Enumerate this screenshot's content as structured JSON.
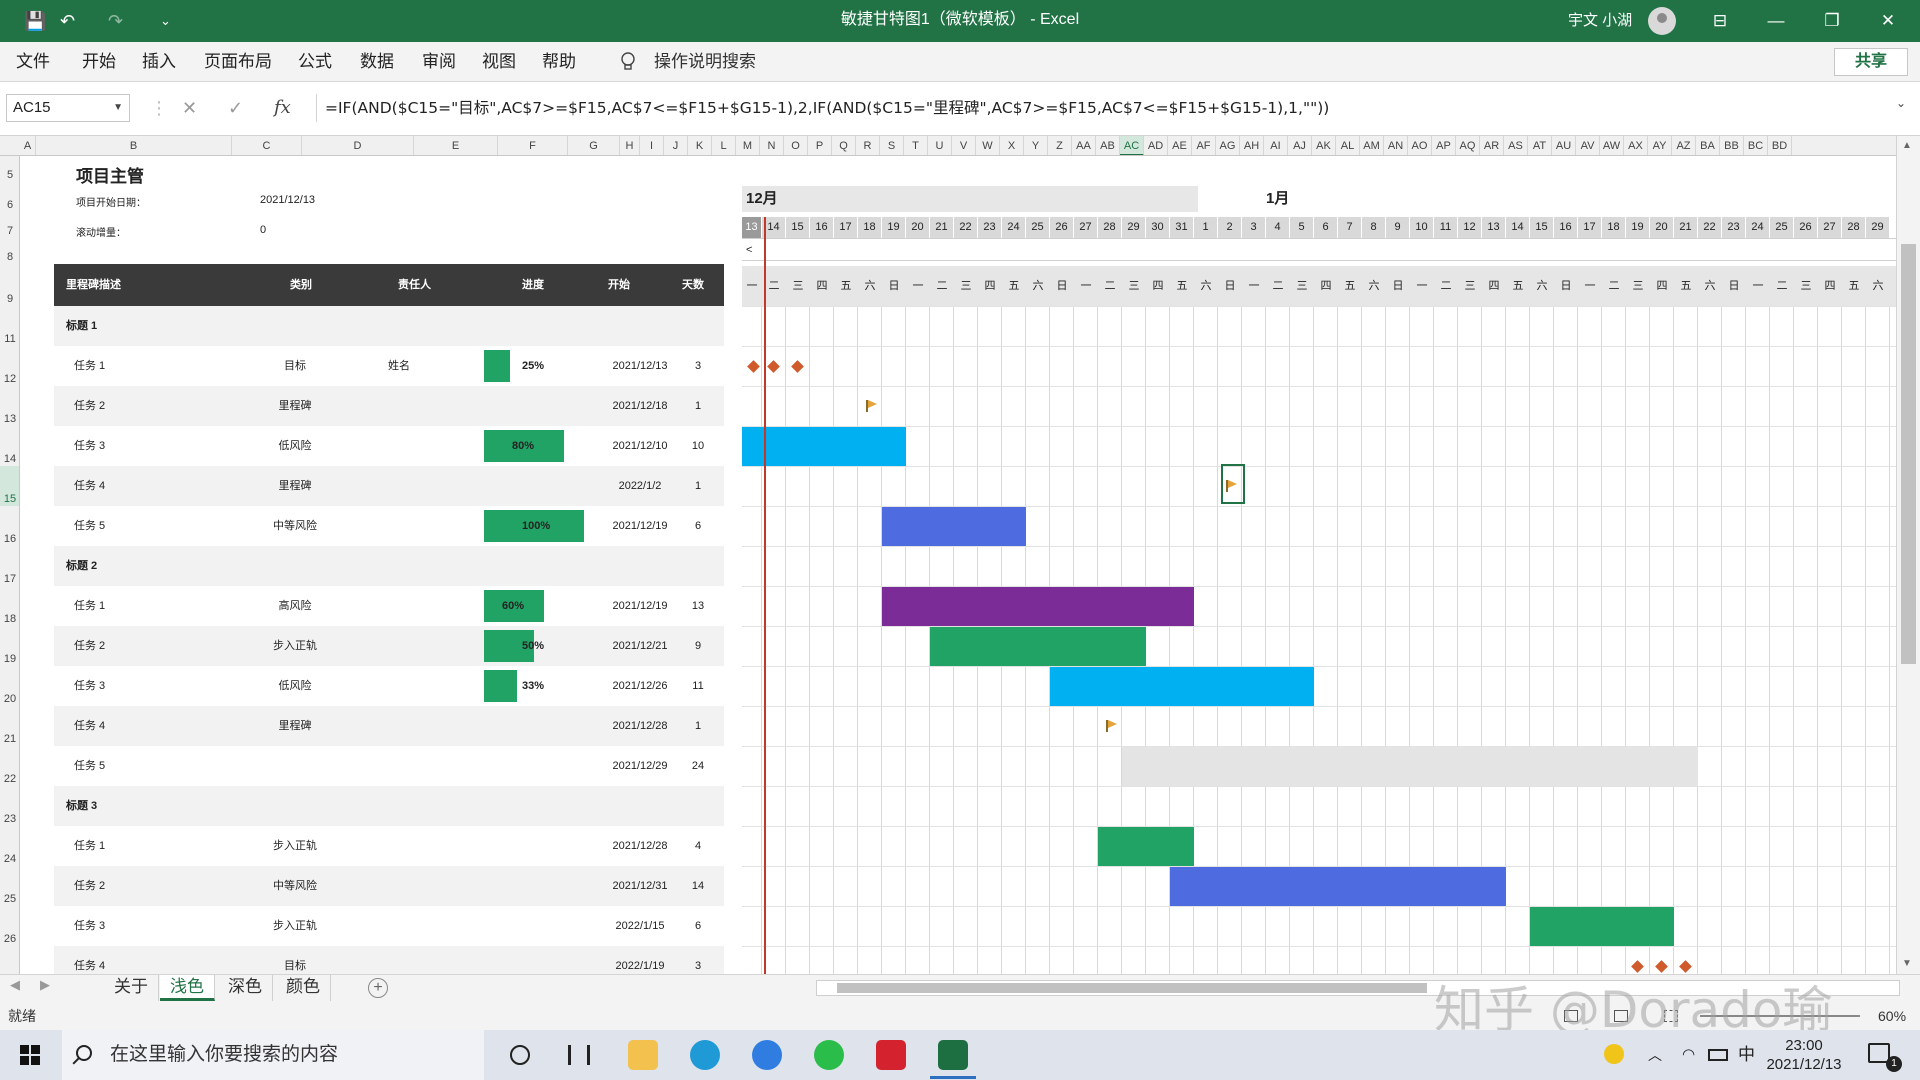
{
  "window": {
    "title": "敏捷甘特图1（微软模板） - Excel",
    "user": "宇文 小湖",
    "buttons": [
      "⊟",
      "—",
      "❐",
      "✕"
    ]
  },
  "quick_access": {
    "save": "💾",
    "undo": "↶",
    "redo": "↷",
    "customize": "⌄"
  },
  "menu": {
    "items": [
      "文件",
      "开始",
      "插入",
      "页面布局",
      "公式",
      "数据",
      "审阅",
      "视图",
      "帮助"
    ],
    "tell_me": "操作说明搜索",
    "share": "共享"
  },
  "formula_bar": {
    "name_box": "AC15",
    "cancel": "✕",
    "enter": "✓",
    "fx": "fx",
    "formula": "=IF(AND($C15=\"目标\",AC$7>=$F15,AC$7<=$F15+$G15-1),2,IF(AND($C15=\"里程碑\",AC$7>=$F15,AC$7<=$F15+$G15-1),1,\"\"))"
  },
  "column_headers": [
    "A",
    "B",
    "C",
    "D",
    "E",
    "F",
    "G",
    "H",
    "I",
    "J",
    "K",
    "L",
    "M",
    "N",
    "O",
    "P",
    "Q",
    "R",
    "S",
    "T",
    "U",
    "V",
    "W",
    "X",
    "Y",
    "Z",
    "AA",
    "AB",
    "AC",
    "AD",
    "AE",
    "AF",
    "AG",
    "AH",
    "AI",
    "AJ",
    "AK",
    "AL",
    "AM",
    "AN",
    "AO",
    "AP",
    "AQ",
    "AR",
    "AS",
    "AT",
    "AU",
    "AV",
    "AW",
    "AX",
    "AY",
    "AZ",
    "BA",
    "BB",
    "BC",
    "BD"
  ],
  "selected_column": "AC",
  "row_headers": [
    "5",
    "6",
    "7",
    "8",
    "9",
    "11",
    "12",
    "13",
    "14",
    "15",
    "16",
    "17",
    "18",
    "19",
    "20",
    "21",
    "22",
    "23",
    "24",
    "25",
    "26"
  ],
  "selected_row": "15",
  "project": {
    "title": "项目主管",
    "start_label": "项目开始日期：",
    "start_value": "2021/12/13",
    "scroll_label": "滚动增量：",
    "scroll_value": "0"
  },
  "table": {
    "headers": [
      "里程碑描述",
      "类别",
      "责任人",
      "进度",
      "开始",
      "天数"
    ],
    "rows": [
      {
        "type": "group",
        "desc": "标题 1",
        "band": true
      },
      {
        "type": "task",
        "desc": "任务 1",
        "category": "目标",
        "owner": "姓名",
        "progress": "25%",
        "progress_value": 0.25,
        "start": "2021/12/13",
        "days": "3",
        "band": false
      },
      {
        "type": "task",
        "desc": "任务 2",
        "category": "里程碑",
        "owner": "",
        "progress": "",
        "progress_value": 0,
        "start": "2021/12/18",
        "days": "1",
        "band": true
      },
      {
        "type": "task",
        "desc": "任务 3",
        "category": "低风险",
        "owner": "",
        "progress": "80%",
        "progress_value": 0.8,
        "start": "2021/12/10",
        "days": "10",
        "band": false
      },
      {
        "type": "task",
        "desc": "任务 4",
        "category": "里程碑",
        "owner": "",
        "progress": "",
        "progress_value": 0,
        "start": "2022/1/2",
        "days": "1",
        "band": true
      },
      {
        "type": "task",
        "desc": "任务 5",
        "category": "中等风险",
        "owner": "",
        "progress": "100%",
        "progress_value": 1.0,
        "start": "2021/12/19",
        "days": "6",
        "band": false
      },
      {
        "type": "group",
        "desc": "标题 2",
        "band": true
      },
      {
        "type": "task",
        "desc": "任务 1",
        "category": "高风险",
        "owner": "",
        "progress": "60%",
        "progress_value": 0.6,
        "start": "2021/12/19",
        "days": "13",
        "band": false
      },
      {
        "type": "task",
        "desc": "任务 2",
        "category": "步入正轨",
        "owner": "",
        "progress": "50%",
        "progress_value": 0.5,
        "start": "2021/12/21",
        "days": "9",
        "band": true
      },
      {
        "type": "task",
        "desc": "任务 3",
        "category": "低风险",
        "owner": "",
        "progress": "33%",
        "progress_value": 0.33,
        "start": "2021/12/26",
        "days": "11",
        "band": false
      },
      {
        "type": "task",
        "desc": "任务 4",
        "category": "里程碑",
        "owner": "",
        "progress": "",
        "progress_value": 0,
        "start": "2021/12/28",
        "days": "1",
        "band": true
      },
      {
        "type": "task",
        "desc": "任务 5",
        "category": "",
        "owner": "",
        "progress": "",
        "progress_value": 0,
        "start": "2021/12/29",
        "days": "24",
        "band": false
      },
      {
        "type": "group",
        "desc": "标题 3",
        "band": true
      },
      {
        "type": "task",
        "desc": "任务 1",
        "category": "步入正轨",
        "owner": "",
        "progress": "",
        "progress_value": 0,
        "start": "2021/12/28",
        "days": "4",
        "band": false
      },
      {
        "type": "task",
        "desc": "任务 2",
        "category": "中等风险",
        "owner": "",
        "progress": "",
        "progress_value": 0,
        "start": "2021/12/31",
        "days": "14",
        "band": true
      },
      {
        "type": "task",
        "desc": "任务 3",
        "category": "步入正轨",
        "owner": "",
        "progress": "",
        "progress_value": 0,
        "start": "2022/1/15",
        "days": "6",
        "band": false
      },
      {
        "type": "task",
        "desc": "任务 4",
        "category": "目标",
        "owner": "",
        "progress": "",
        "progress_value": 0,
        "start": "2022/1/19",
        "days": "3",
        "band": true
      }
    ]
  },
  "timeline": {
    "months": [
      "12月",
      "1月"
    ],
    "days": [
      "13",
      "14",
      "15",
      "16",
      "17",
      "18",
      "19",
      "20",
      "21",
      "22",
      "23",
      "24",
      "25",
      "26",
      "27",
      "28",
      "29",
      "30",
      "31",
      "1",
      "2",
      "3",
      "4",
      "5",
      "6",
      "7",
      "8",
      "9",
      "10",
      "11",
      "12",
      "13",
      "14",
      "15",
      "16",
      "17",
      "18",
      "19",
      "20",
      "21",
      "22",
      "23",
      "24",
      "25",
      "26",
      "27",
      "28",
      "29"
    ],
    "weekdays": [
      "一",
      "二",
      "三",
      "四",
      "五",
      "六",
      "日",
      "一",
      "二",
      "三",
      "四",
      "五",
      "六",
      "日",
      "一",
      "二",
      "三",
      "四",
      "五",
      "六",
      "日",
      "一",
      "二",
      "三",
      "四",
      "五",
      "六",
      "日",
      "一",
      "二",
      "三",
      "四",
      "五",
      "六",
      "日",
      "一",
      "二",
      "三",
      "四",
      "五",
      "六",
      "日",
      "一",
      "二",
      "三",
      "四",
      "五",
      "六"
    ],
    "scroll_left": "<"
  },
  "colors": {
    "excel_green": "#217346",
    "low_risk": "#00b0f0",
    "medium_risk": "#4e6be0",
    "high_risk": "#7b2c96",
    "on_track": "#21a366",
    "unassigned": "#e4e4e4",
    "goal": "#cf5a2c",
    "milestone": "#e5a53a",
    "progress": "#21a366"
  },
  "sheet_tabs": [
    "关于",
    "浅色",
    "深色",
    "颜色"
  ],
  "active_tab": "浅色",
  "status": {
    "ready": "就绪",
    "zoom": "60%"
  },
  "watermark": "知乎 @Dorado瑜",
  "taskbar": {
    "search_placeholder": "在这里输入你要搜索的内容",
    "ime": "中",
    "time": "23:00",
    "date": "2021/12/13",
    "notifications": "1"
  }
}
